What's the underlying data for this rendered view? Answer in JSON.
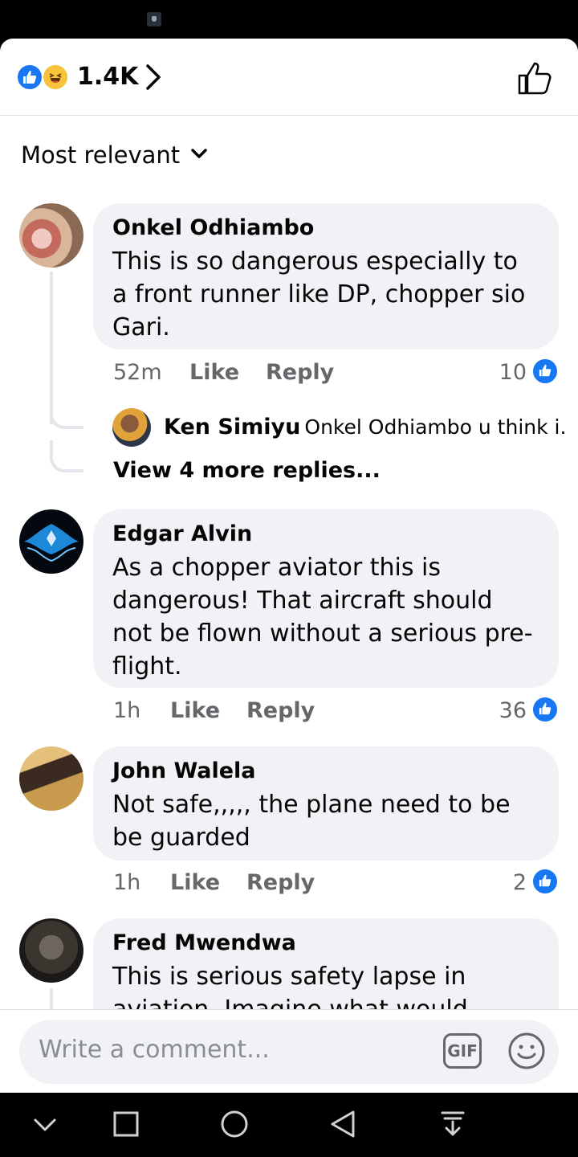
{
  "reactions": {
    "count": "1.4K",
    "icons": [
      "like-icon",
      "haha-icon"
    ]
  },
  "sort": {
    "label": "Most relevant"
  },
  "comments": [
    {
      "author": "Onkel Odhiambo",
      "text": "This is so dangerous especially to a front runner like DP, chopper sio Gari.",
      "time": "52m",
      "like_label": "Like",
      "reply_label": "Reply",
      "likes": "10",
      "reply_preview": {
        "author": "Ken Simiyu",
        "text": "Onkel Odhiambo u think i..."
      },
      "view_more": "View 4 more replies..."
    },
    {
      "author": "Edgar Alvin",
      "text": "As a chopper aviator this is dangerous! That aircraft should not be flown without a serious pre-flight.",
      "time": "1h",
      "like_label": "Like",
      "reply_label": "Reply",
      "likes": "36"
    },
    {
      "author": "John Walela",
      "text": "Not safe,,,,, the plane need to be be guarded",
      "time": "1h",
      "like_label": "Like",
      "reply_label": "Reply",
      "likes": "2"
    },
    {
      "author": "Fred Mwendwa",
      "text": "This is serious safety lapse in aviation. Imagine what would"
    }
  ],
  "composer": {
    "placeholder": "Write a comment...",
    "gif_label": "GIF"
  },
  "colors": {
    "brand": "#1877f2",
    "bubble": "#f0f2f5",
    "meta": "#65676b"
  },
  "nav": [
    "chevron-down-icon",
    "square-icon",
    "circle-icon",
    "triangle-back-icon",
    "download-icon"
  ]
}
